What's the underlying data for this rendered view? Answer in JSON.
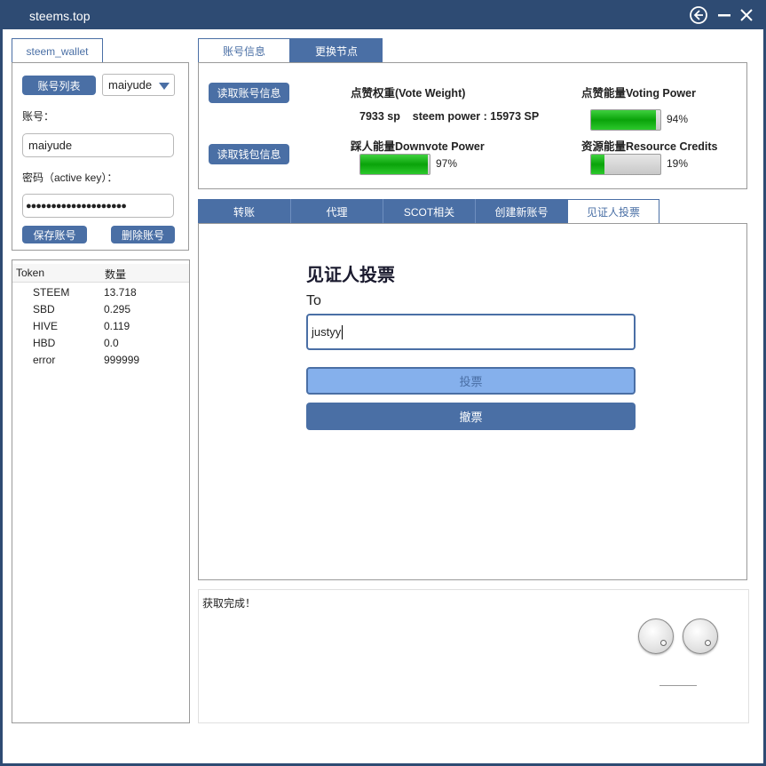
{
  "window": {
    "title": "steems.top"
  },
  "left": {
    "tab_label": "steem_wallet",
    "account_list_button": "账号列表",
    "account_select_value": "maiyude",
    "account_label": "账号：",
    "account_value": "maiyude",
    "password_label": "密码（active key）：",
    "password_value": "●●●●●●●●●●●●●●●●●●●●",
    "save_button": "保存账号",
    "delete_button": "删除账号"
  },
  "tokens": {
    "headers": [
      "Token",
      "数量"
    ],
    "rows": [
      {
        "name": "STEEM",
        "amount": "13.718"
      },
      {
        "name": "SBD",
        "amount": "0.295"
      },
      {
        "name": "HIVE",
        "amount": "0.119"
      },
      {
        "name": "HBD",
        "amount": "0.0"
      },
      {
        "name": "error",
        "amount": "999999"
      }
    ]
  },
  "top_tabs": [
    {
      "label": "账号信息",
      "active": true
    },
    {
      "label": "更换节点",
      "active": false
    }
  ],
  "account_info": {
    "read_account_button": "读取账号信息",
    "read_wallet_button": "读取钱包信息",
    "vote_weight_label": "点赞权重(Vote Weight)",
    "vote_weight_value": "7933 sp    steem power : 15973 SP",
    "voting_power_label": "点赞能量Voting Power",
    "voting_power_value": 94,
    "voting_power_text": "94%",
    "downvote_label": "踩人能量Downvote Power",
    "downvote_value": 97,
    "downvote_text": "97%",
    "rc_label": "资源能量Resource Credits",
    "rc_value": 19,
    "rc_text": "19%"
  },
  "main_tabs": [
    {
      "label": "转账",
      "active": false
    },
    {
      "label": "代理",
      "active": false
    },
    {
      "label": "SCOT相关",
      "active": false
    },
    {
      "label": "创建新账号",
      "active": false
    },
    {
      "label": "见证人投票",
      "active": true
    }
  ],
  "witness": {
    "heading": "见证人投票",
    "to_label": "To",
    "to_value": "justyy",
    "vote_button": "投票",
    "unvote_button": "撤票"
  },
  "log": {
    "text": "获取完成！"
  },
  "colors": {
    "titlebar": "#2e4b73",
    "accent": "#4a6fa5",
    "accent_light": "#85b0ec",
    "bar_green": "#12b012"
  }
}
